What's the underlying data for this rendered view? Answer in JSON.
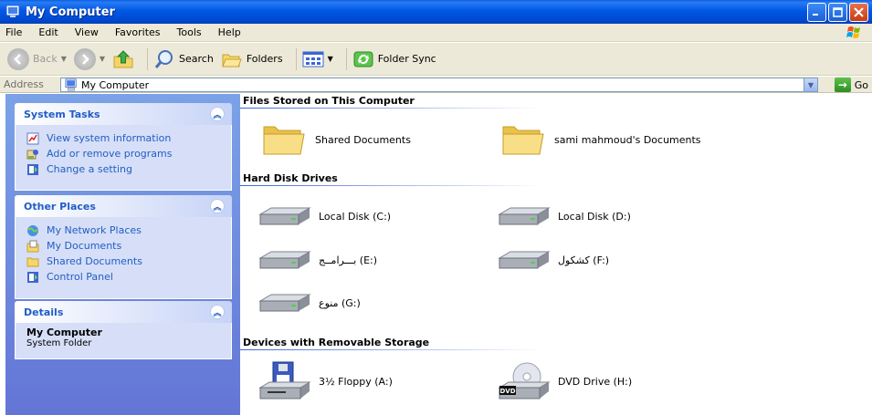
{
  "window": {
    "title": "My Computer"
  },
  "menu": {
    "items": [
      "File",
      "Edit",
      "View",
      "Favorites",
      "Tools",
      "Help"
    ]
  },
  "toolbar": {
    "back_label": "Back",
    "search_label": "Search",
    "folders_label": "Folders",
    "folder_sync_label": "Folder Sync"
  },
  "address": {
    "label": "Address",
    "value": "My Computer",
    "go_label": "Go"
  },
  "sidebar": {
    "system_tasks": {
      "title": "System Tasks",
      "items": [
        "View system information",
        "Add or remove programs",
        "Change a setting"
      ]
    },
    "other_places": {
      "title": "Other Places",
      "items": [
        "My Network Places",
        "My Documents",
        "Shared Documents",
        "Control Panel"
      ]
    },
    "details": {
      "title": "Details",
      "name": "My Computer",
      "type": "System Folder"
    }
  },
  "content": {
    "groups": [
      {
        "title": "Files Stored on This Computer",
        "items": [
          "Shared Documents",
          "sami mahmoud's Documents"
        ]
      },
      {
        "title": "Hard Disk Drives",
        "items": [
          "Local Disk (C:)",
          "Local Disk (D:)",
          "بـــرامــج (E:)",
          "كشكول (F:)",
          "منوع (G:)"
        ]
      },
      {
        "title": "Devices with Removable Storage",
        "items": [
          "3½ Floppy (A:)",
          "DVD Drive (H:)"
        ]
      }
    ]
  },
  "colors": {
    "titlebar": "#0058e6",
    "sidebar": "#6c86dc",
    "link": "#215dc6"
  }
}
